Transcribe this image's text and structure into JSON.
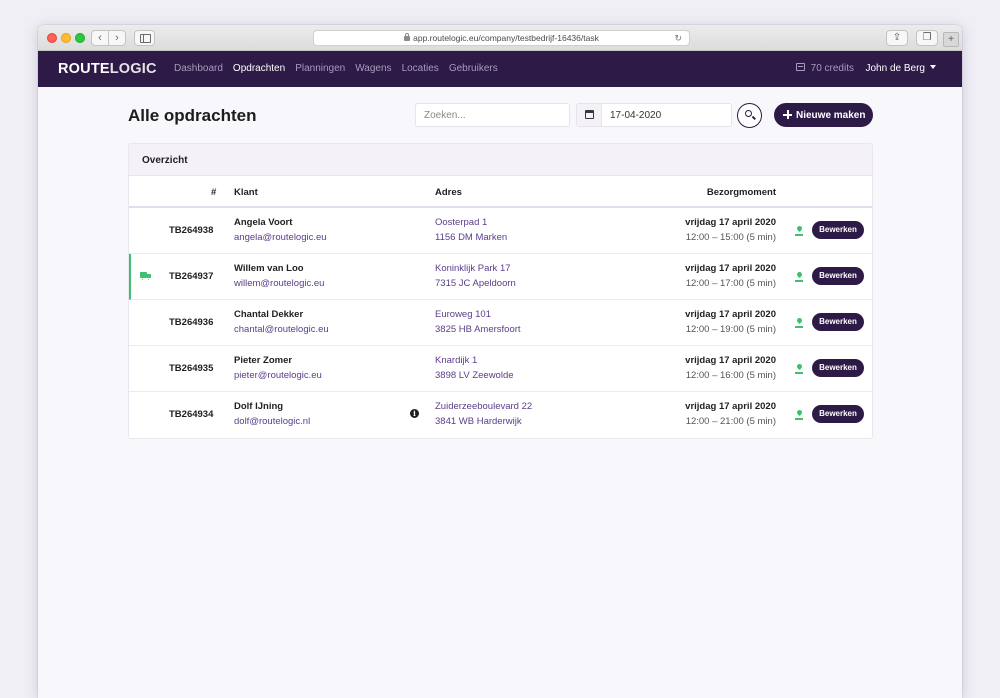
{
  "browser": {
    "url": "app.routelogic.eu/company/testbedrijf-16436/task"
  },
  "nav": {
    "logo_part1": "ROUTE",
    "logo_part2": "LOGIC",
    "items": [
      {
        "label": "Dashboard",
        "active": false
      },
      {
        "label": "Opdrachten",
        "active": true
      },
      {
        "label": "Planningen",
        "active": false
      },
      {
        "label": "Wagens",
        "active": false
      },
      {
        "label": "Locaties",
        "active": false
      },
      {
        "label": "Gebruikers",
        "active": false
      }
    ],
    "credits": "70 credits",
    "user": "John de Berg"
  },
  "page": {
    "title": "Alle opdrachten",
    "search_placeholder": "Zoeken...",
    "date_value": "17-04-2020",
    "new_button": "Nieuwe maken"
  },
  "table": {
    "panel_title": "Overzicht",
    "columns": {
      "id": "#",
      "client": "Klant",
      "address": "Adres",
      "moment": "Bezorgmoment"
    },
    "edit_label": "Bewerken",
    "rows": [
      {
        "id": "TB264938",
        "name": "Angela Voort",
        "email": "angela@routelogic.eu",
        "address1": "Oosterpad 1",
        "address2": "1156 DM Marken",
        "day": "vrijdag 17 april 2020",
        "time": "12:00 – 15:00 (5 min)"
      },
      {
        "id": "TB264937",
        "name": "Willem van Loo",
        "email": "willem@routelogic.eu",
        "address1": "Koninklijk Park 17",
        "address2": "7315 JC Apeldoorn",
        "day": "vrijdag 17 april 2020",
        "time": "12:00 – 17:00 (5 min)"
      },
      {
        "id": "TB264936",
        "name": "Chantal Dekker",
        "email": "chantal@routelogic.eu",
        "address1": "Euroweg 101",
        "address2": "3825 HB Amersfoort",
        "day": "vrijdag 17 april 2020",
        "time": "12:00 – 19:00 (5 min)"
      },
      {
        "id": "TB264935",
        "name": "Pieter Zomer",
        "email": "pieter@routelogic.eu",
        "address1": "Knardijk 1",
        "address2": "3898 LV Zeewolde",
        "day": "vrijdag 17 april 2020",
        "time": "12:00 – 16:00 (5 min)"
      },
      {
        "id": "TB264934",
        "name": "Dolf IJning",
        "email": "dolf@routelogic.nl",
        "address1": "Zuiderzeeboulevard 22",
        "address2": "3841 WB Harderwijk",
        "day": "vrijdag 17 april 2020",
        "time": "12:00 – 21:00 (5 min)"
      }
    ]
  },
  "colors": {
    "brand": "#2e1a47",
    "link": "#5b3d8a",
    "success": "#3fbf70"
  }
}
